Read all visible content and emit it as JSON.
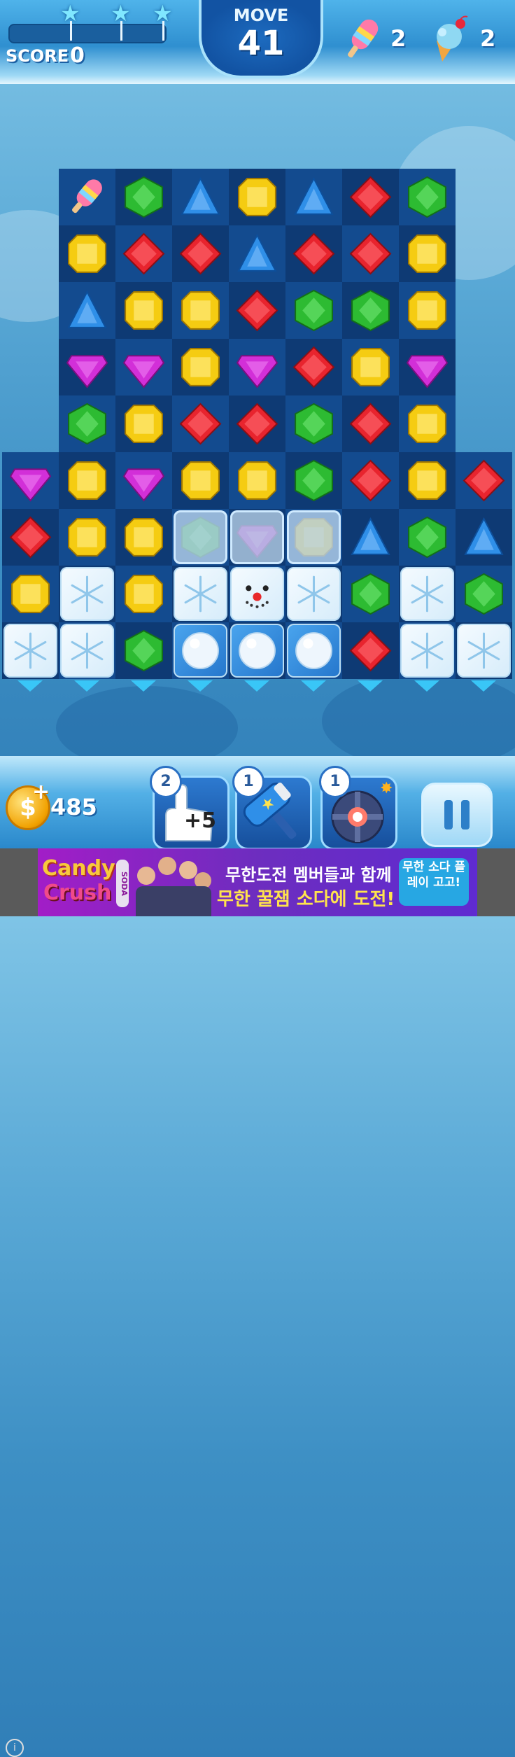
{
  "hud": {
    "score_label": "SCORE",
    "score_value": "0",
    "move_label": "MOVE",
    "move_value": "41",
    "progress": 0,
    "stars": 3,
    "goals": [
      {
        "icon": "popsicle-icon",
        "count": "2"
      },
      {
        "icon": "ice-cream-icon",
        "count": "2"
      }
    ]
  },
  "board": {
    "cols": 9,
    "rows": 9,
    "grid": [
      [
        "empty",
        "popsicle",
        "green",
        "blue",
        "yellow",
        "blue",
        "red",
        "green",
        "empty"
      ],
      [
        "empty",
        "yellow",
        "red",
        "red",
        "blue",
        "red",
        "red",
        "yellow",
        "empty"
      ],
      [
        "empty",
        "blue",
        "yellow",
        "yellow",
        "red",
        "green",
        "green",
        "yellow",
        "empty"
      ],
      [
        "empty",
        "purple",
        "purple",
        "yellow",
        "purple",
        "red",
        "yellow",
        "purple",
        "empty"
      ],
      [
        "empty",
        "green",
        "yellow",
        "red",
        "red",
        "green",
        "red",
        "yellow",
        "empty"
      ],
      [
        "purple",
        "yellow",
        "purple",
        "yellow",
        "yellow",
        "green",
        "red",
        "yellow",
        "red"
      ],
      [
        "red",
        "yellow",
        "yellow",
        "frozen-green",
        "frozen-purple",
        "frozen-yellow",
        "blue",
        "green",
        "blue"
      ],
      [
        "yellow",
        "snow",
        "yellow",
        "snow",
        "snowman",
        "snow",
        "green",
        "snow",
        "green"
      ],
      [
        "snow",
        "snow",
        "green",
        "snowball",
        "snowball",
        "snowball",
        "red",
        "snow",
        "snow"
      ]
    ],
    "exit_arrows": 9
  },
  "footer": {
    "coins": "485",
    "boosters": [
      {
        "icon": "extra-moves-hand-icon",
        "count": "2",
        "label": "+5"
      },
      {
        "icon": "hammer-icon",
        "count": "1"
      },
      {
        "icon": "bomb-icon",
        "count": "1"
      }
    ],
    "pause_icon": "pause-icon"
  },
  "ad": {
    "brand_line1": "Candy",
    "brand_line2": "Crush",
    "brand_tag": "SODA",
    "line1": "무한도전 멤버들과 함께",
    "line2": "무한 꿀잼 소다에 도전!",
    "cta": "무한 소다 플레이 고고!",
    "info_icon": "info-icon"
  },
  "colors": {
    "red": "#e8242e",
    "green": "#2dbb32",
    "blue": "#2f8fe8",
    "yellow": "#f5cc12",
    "purple": "#d22fd8",
    "board_dark": "#0e3a74",
    "board_light": "#134b8f"
  }
}
